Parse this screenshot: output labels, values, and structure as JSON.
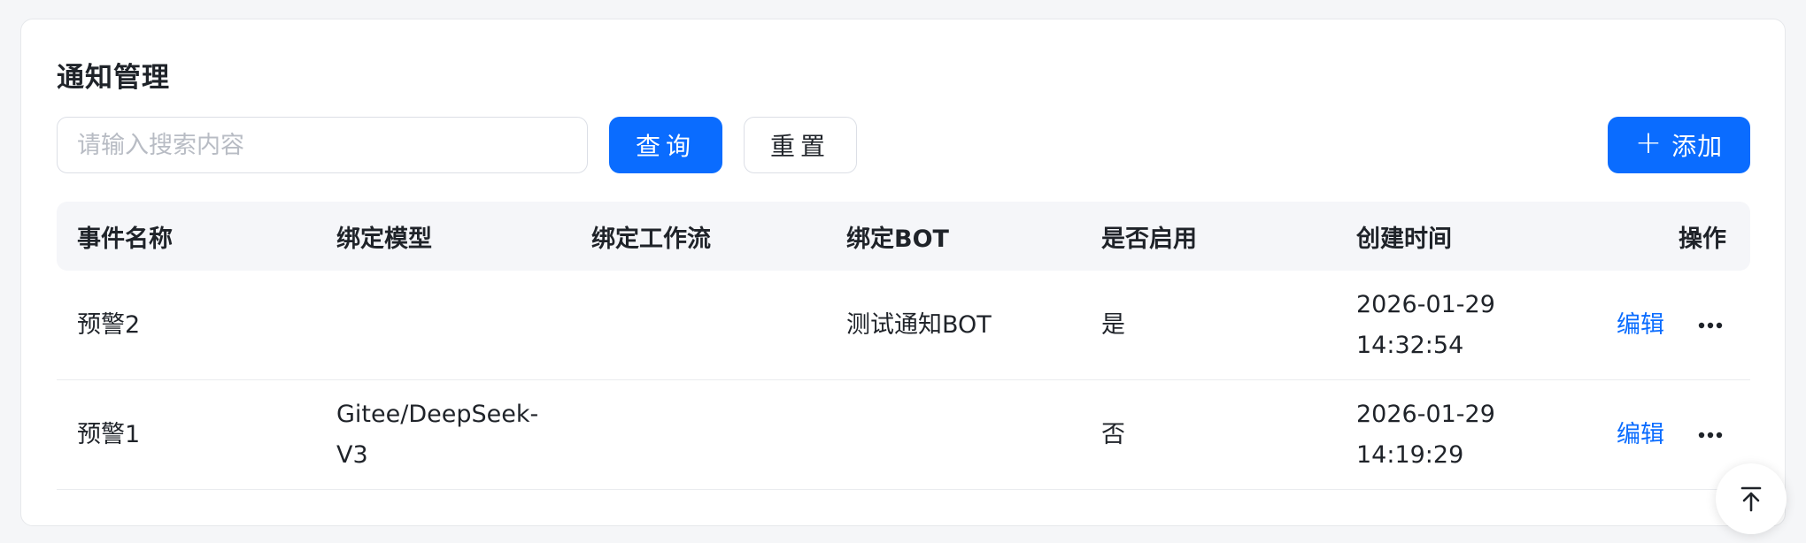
{
  "page": {
    "title": "通知管理"
  },
  "toolbar": {
    "search_placeholder": "请输入搜索内容",
    "query_label": "查询",
    "reset_label": "重置",
    "add_label": "添加"
  },
  "table": {
    "columns": [
      "事件名称",
      "绑定模型",
      "绑定工作流",
      "绑定BOT",
      "是否启用",
      "创建时间",
      "操作"
    ],
    "rows": [
      {
        "event_name": "预警2",
        "model": "",
        "workflow": "",
        "bot": "测试通知BOT",
        "enabled": "是",
        "created_date": "2026-01-29",
        "created_time": "14:32:54",
        "action_label": "编辑"
      },
      {
        "event_name": "预警1",
        "model_line1": "Gitee/DeepSeek-",
        "model_line2": "V3",
        "workflow": "",
        "bot": "",
        "enabled": "否",
        "created_date": "2026-01-29",
        "created_time": "14:19:29",
        "action_label": "编辑"
      }
    ]
  },
  "colors": {
    "primary": "#0a6cff",
    "header_bg": "#f5f6f9",
    "page_bg": "#f5f6f8"
  },
  "icons": {
    "more": "ellipsis-icon",
    "back_to_top": "arrow-up-to-line-icon",
    "add": "plus-icon"
  }
}
